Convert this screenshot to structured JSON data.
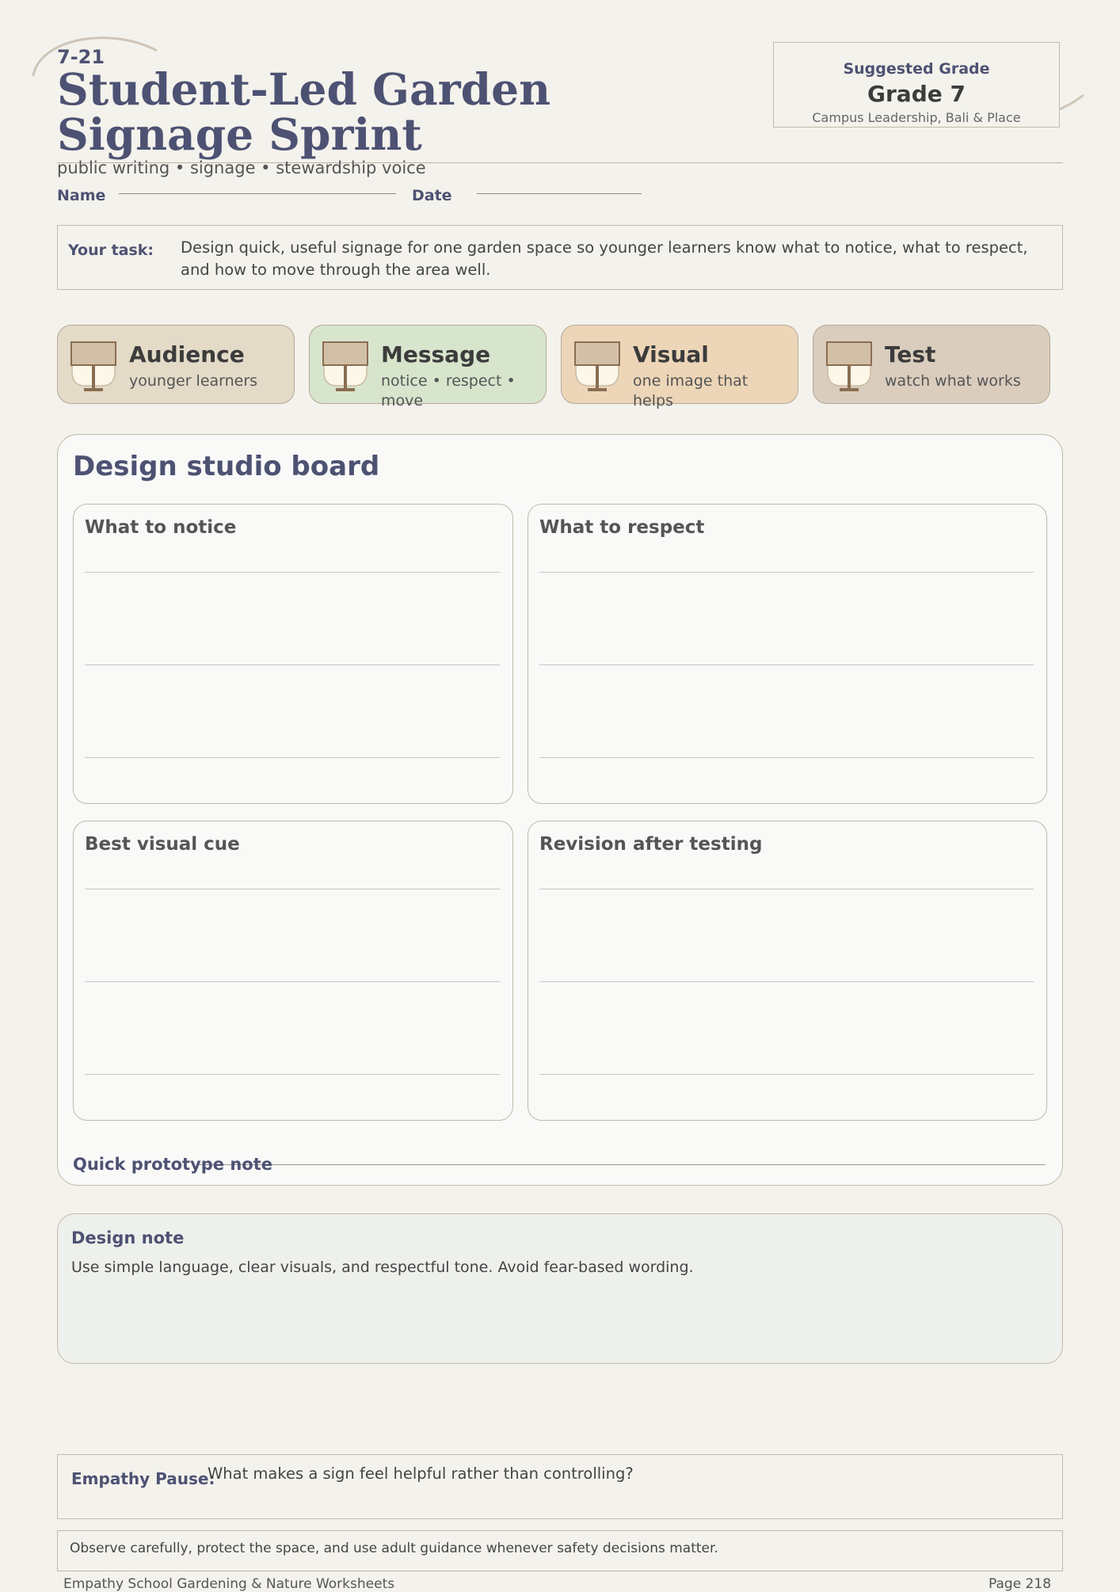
{
  "header": {
    "code": "7-21",
    "title": "Student-Led Garden Signage Sprint",
    "subtitle": "public writing • signage • stewardship voice",
    "name_label": "Name",
    "date_label": "Date"
  },
  "grade_box": {
    "label": "Suggested Grade",
    "grade": "Grade 7",
    "strand": "Campus Leadership, Bali & Place"
  },
  "task": {
    "label": "Your task:",
    "text": "Design quick, useful signage for one garden space so younger learners know what to notice, what to respect, and how to move through the area well."
  },
  "cards": [
    {
      "title": "Audience",
      "subtitle": "younger learners",
      "color": "#e3dac8",
      "icon": "signpost-icon"
    },
    {
      "title": "Message",
      "subtitle": "notice • respect • move",
      "color": "#d8e5cd",
      "icon": "signpost-icon"
    },
    {
      "title": "Visual",
      "subtitle": "one image that helps",
      "color": "#edd6b8",
      "icon": "signpost-icon"
    },
    {
      "title": "Test",
      "subtitle": "watch what works",
      "color": "#dacdbd",
      "icon": "signpost-icon"
    }
  ],
  "board": {
    "title": "Design studio board",
    "panels": [
      {
        "title": "What to notice"
      },
      {
        "title": "What to respect"
      },
      {
        "title": "Best visual cue"
      },
      {
        "title": "Revision after testing"
      }
    ],
    "prototype_label": "Quick prototype note"
  },
  "design_note": {
    "title": "Design note",
    "text": "Use simple language, clear visuals, and respectful tone. Avoid fear-based wording."
  },
  "empathy": {
    "label": "Empathy Pause:",
    "question": "What makes a sign feel helpful rather than controlling?"
  },
  "safety": "Observe carefully, protect the space, and use adult guidance whenever safety decisions matter.",
  "footer": {
    "left": "Empathy School Gardening & Nature Worksheets",
    "right": "Page 218"
  },
  "colors": {
    "accent": "#4d5273",
    "background": "#f4f2ec",
    "border": "#c2b9aa"
  }
}
